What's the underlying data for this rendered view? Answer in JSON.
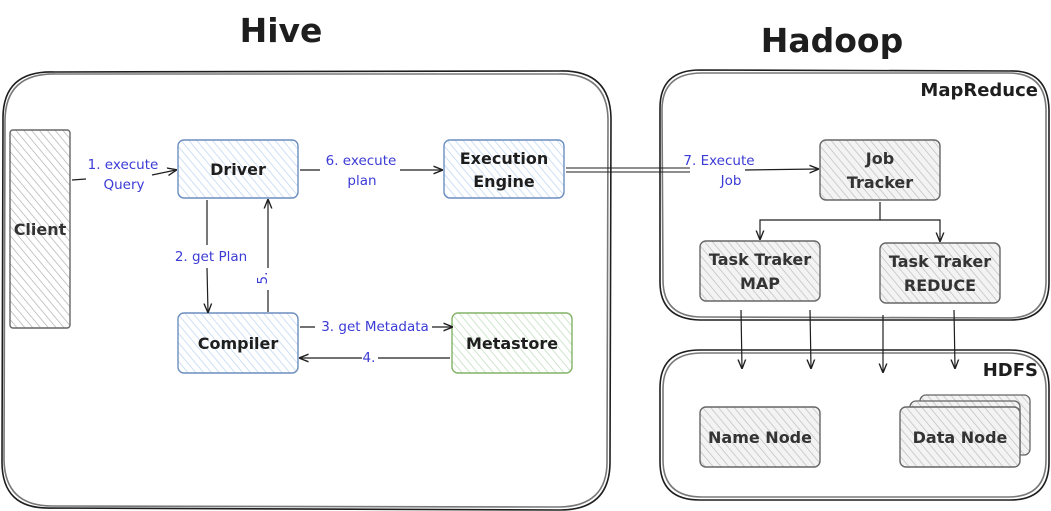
{
  "titles": {
    "hive": "Hive",
    "hadoop": "Hadoop"
  },
  "groups": {
    "mapreduce": "MapReduce",
    "hdfs": "HDFS"
  },
  "nodes": {
    "client": "Client",
    "driver": "Driver",
    "execution_engine": [
      "Execution",
      "Engine"
    ],
    "compiler": "Compiler",
    "metastore": "Metastore",
    "job_tracker": [
      "Job",
      "Tracker"
    ],
    "task_tracker_map": [
      "Task Traker",
      "MAP"
    ],
    "task_tracker_reduce": [
      "Task Traker",
      "REDUCE"
    ],
    "name_node": "Name Node",
    "data_node": "Data Node"
  },
  "edges": {
    "execute_query": [
      "1. execute",
      "Query"
    ],
    "get_plan": "2. get Plan",
    "get_metadata": "3. get Metadata",
    "metadata_return": "4.",
    "plan_return": "5.",
    "execute_plan": [
      "6. execute",
      "plan"
    ],
    "execute_job": [
      "7. Execute",
      "Job"
    ]
  },
  "colors": {
    "blue_stroke": "#6c8ebf",
    "blue_fill": "#dae8fc",
    "green_stroke": "#82b366",
    "green_fill": "#d5e8d4",
    "gray_stroke": "#666666",
    "gray_fill": "#f5f5f5",
    "edge_label": "#3b3bd6"
  }
}
